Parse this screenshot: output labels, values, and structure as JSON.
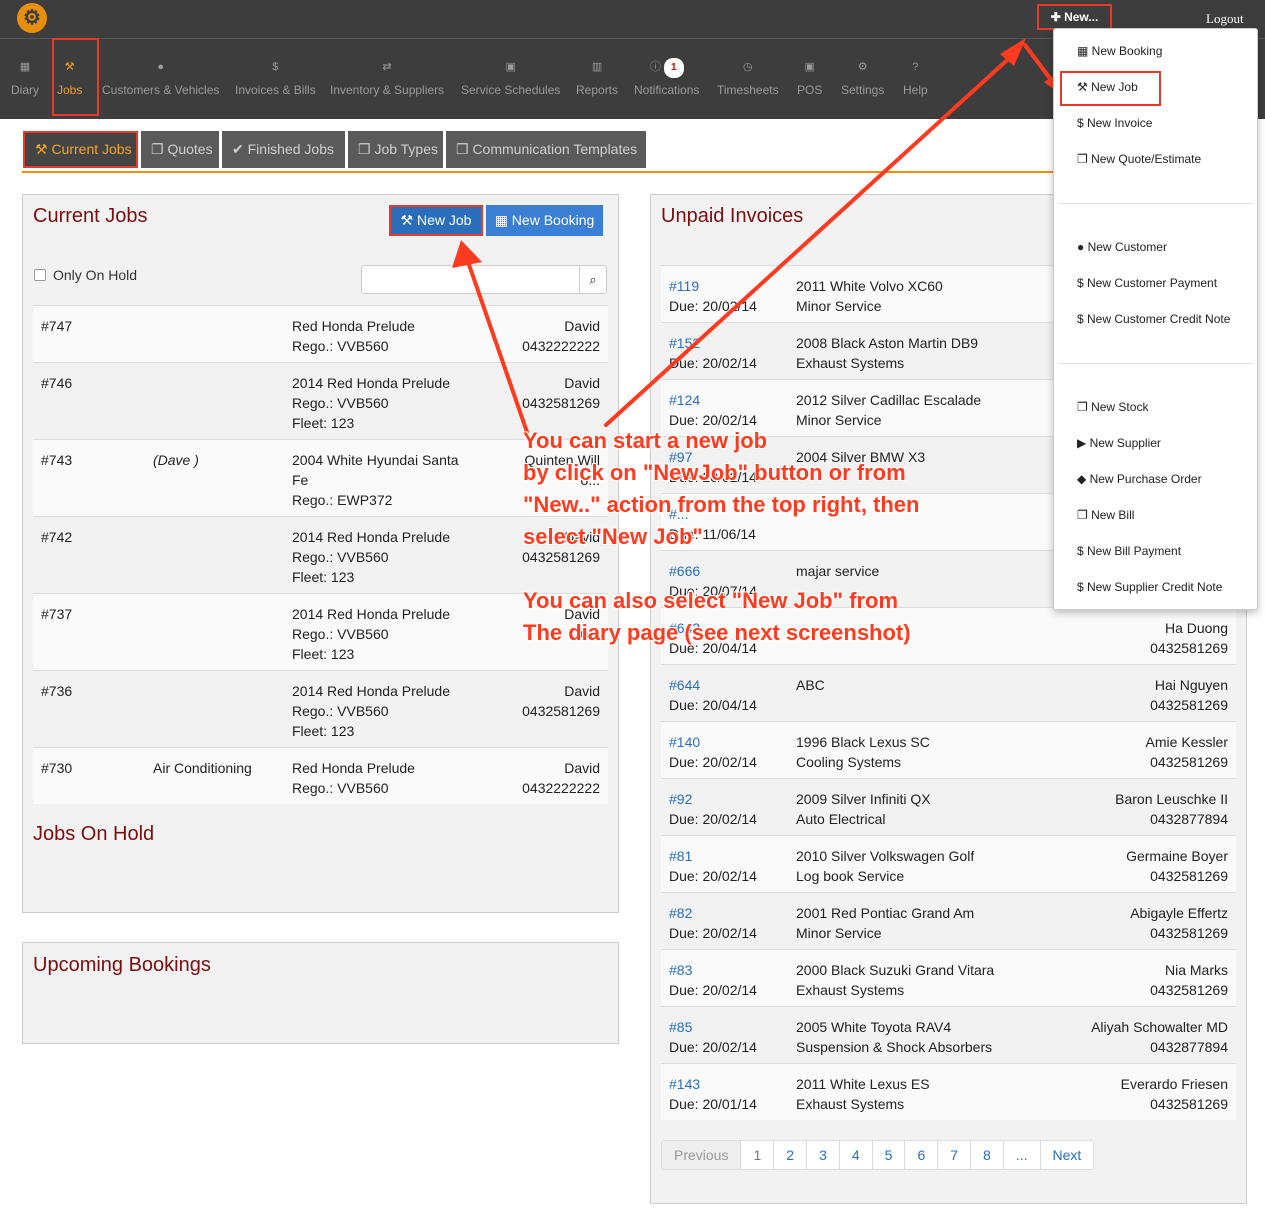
{
  "topbar": {
    "logo": "⚙",
    "new_label": "✚ New...",
    "logout_label": "Logout"
  },
  "nav": [
    {
      "label": "Diary",
      "icon": "▦"
    },
    {
      "label": "Jobs",
      "icon": "⚒"
    },
    {
      "label": "Customers & Vehicles",
      "icon": "●"
    },
    {
      "label": "Invoices & Bills",
      "icon": "$"
    },
    {
      "label": "Inventory & Suppliers",
      "icon": "⇄"
    },
    {
      "label": "Service Schedules",
      "icon": "▣"
    },
    {
      "label": "Reports",
      "icon": "▥"
    },
    {
      "label": "Notifications",
      "icon": "ⓘ",
      "badge": "1"
    },
    {
      "label": "Timesheets",
      "icon": "◷"
    },
    {
      "label": "POS",
      "icon": "▣"
    },
    {
      "label": "Settings",
      "icon": "⚙"
    },
    {
      "label": "Help",
      "icon": "?"
    }
  ],
  "tabs": [
    "⚒ Current Jobs",
    "❐ Quotes",
    "✔ Finished Jobs",
    "❐ Job Types",
    "❐ Communication Templates"
  ],
  "current_jobs": {
    "title": "Current Jobs",
    "new_job_label": "⚒ New Job",
    "new_booking_label": "▦ New Booking",
    "only_on_hold_label": "Only On Hold",
    "search_icon": "⌕",
    "rows": [
      {
        "id": "#747",
        "note": "",
        "vehicle": [
          "Red Honda Prelude",
          "Rego.: VVB560"
        ],
        "contact": [
          "David",
          "0432222222"
        ]
      },
      {
        "id": "#746",
        "note": "",
        "vehicle": [
          "2014 Red Honda Prelude",
          "Rego.: VVB560",
          "Fleet: 123"
        ],
        "contact": [
          "David",
          "0432581269"
        ]
      },
      {
        "id": "#743",
        "note": "(Dave )",
        "vehicle": [
          "2004 White Hyundai Santa",
          "Fe",
          "Rego.: EWP372"
        ],
        "contact": [
          "Quinten Will",
          "o..."
        ]
      },
      {
        "id": "#742",
        "note": "",
        "vehicle": [
          "2014 Red Honda Prelude",
          "Rego.: VVB560",
          "Fleet: 123"
        ],
        "contact": [
          "David",
          "0432581269"
        ]
      },
      {
        "id": "#737",
        "note": "",
        "vehicle": [
          "2014 Red Honda Prelude",
          "Rego.: VVB560",
          "Fleet: 123"
        ],
        "contact": [
          "David",
          "0..."
        ]
      },
      {
        "id": "#736",
        "note": "",
        "vehicle": [
          "2014 Red Honda Prelude",
          "Rego.: VVB560",
          "Fleet: 123"
        ],
        "contact": [
          "David",
          "0432581269"
        ]
      },
      {
        "id": "#730",
        "note": "Air Conditioning",
        "vehicle": [
          "Red Honda Prelude",
          "Rego.: VVB560"
        ],
        "contact": [
          "David",
          "0432222222"
        ]
      }
    ]
  },
  "jobs_on_hold": {
    "title": "Jobs On Hold"
  },
  "upcoming_bookings": {
    "title": "Upcoming Bookings"
  },
  "unpaid_invoices": {
    "title": "Unpaid Invoices",
    "rows": [
      {
        "id": "#119",
        "due": "Due: 20/02/14",
        "vehicle": [
          "2011 White Volvo XC60",
          "Minor Service"
        ],
        "customer": [
          "",
          ""
        ]
      },
      {
        "id": "#152",
        "due": "Due: 20/02/14",
        "vehicle": [
          "2008 Black Aston Martin DB9",
          "Exhaust Systems"
        ],
        "customer": [
          "",
          ""
        ]
      },
      {
        "id": "#124",
        "due": "Due: 20/02/14",
        "vehicle": [
          "2012 Silver Cadillac Escalade",
          "Minor Service"
        ],
        "customer": [
          "",
          ""
        ]
      },
      {
        "id": "#97",
        "due": "Due: 20/02/14",
        "vehicle": [
          "2004 Silver BMW X3",
          ""
        ],
        "customer": [
          "",
          ""
        ]
      },
      {
        "id": "#...",
        "due": "Due: 11/06/14",
        "vehicle": [
          "",
          ""
        ],
        "customer": [
          "",
          ""
        ]
      },
      {
        "id": "#666",
        "due": "Due: 20/07/14",
        "vehicle": [
          "majar service",
          ""
        ],
        "customer": [
          "",
          ""
        ]
      },
      {
        "id": "#643",
        "due": "Due: 20/04/14",
        "vehicle": [
          "",
          ""
        ],
        "customer": [
          "Ha Duong",
          "0432581269"
        ]
      },
      {
        "id": "#644",
        "due": "Due: 20/04/14",
        "vehicle": [
          "ABC",
          ""
        ],
        "customer": [
          "Hai Nguyen",
          "0432581269"
        ]
      },
      {
        "id": "#140",
        "due": "Due: 20/02/14",
        "vehicle": [
          "1996 Black Lexus SC",
          "Cooling Systems"
        ],
        "customer": [
          "Amie Kessler",
          "0432581269"
        ]
      },
      {
        "id": "#92",
        "due": "Due: 20/02/14",
        "vehicle": [
          "2009 Silver Infiniti QX",
          "Auto Electrical"
        ],
        "customer": [
          "Baron Leuschke II",
          "0432877894"
        ]
      },
      {
        "id": "#81",
        "due": "Due: 20/02/14",
        "vehicle": [
          "2010 Silver Volkswagen Golf",
          "Log book Service"
        ],
        "customer": [
          "Germaine Boyer",
          "0432581269"
        ]
      },
      {
        "id": "#82",
        "due": "Due: 20/02/14",
        "vehicle": [
          "2001 Red Pontiac Grand Am",
          "Minor Service"
        ],
        "customer": [
          "Abigayle Effertz",
          "0432581269"
        ]
      },
      {
        "id": "#83",
        "due": "Due: 20/02/14",
        "vehicle": [
          "2000 Black Suzuki Grand Vitara",
          "Exhaust Systems"
        ],
        "customer": [
          "Nia Marks",
          "0432581269"
        ]
      },
      {
        "id": "#85",
        "due": "Due: 20/02/14",
        "vehicle": [
          "2005 White Toyota RAV4",
          "Suspension & Shock Absorbers"
        ],
        "customer": [
          "Aliyah Schowalter MD",
          "0432877894"
        ]
      },
      {
        "id": "#143",
        "due": "Due: 20/01/14",
        "vehicle": [
          "2011 White Lexus ES",
          "Exhaust Systems"
        ],
        "customer": [
          "Everardo Friesen",
          "0432581269"
        ]
      }
    ]
  },
  "pager": [
    "Previous",
    "1",
    "2",
    "3",
    "4",
    "5",
    "6",
    "7",
    "8",
    "...",
    "Next"
  ],
  "dropdown": {
    "group1": [
      "▦ New Booking",
      "⚒ New Job",
      "$ New Invoice",
      "❐ New Quote/Estimate"
    ],
    "group2": [
      "● New Customer",
      "$ New Customer Payment",
      "$ New Customer Credit Note"
    ],
    "group3": [
      "❐ New Stock",
      "▶ New Supplier",
      "◆ New Purchase Order",
      "❐ New Bill",
      "$ New Bill Payment",
      "$ New Supplier Credit Note"
    ]
  },
  "annotations": {
    "main": "You can start a new job\nby click on \"NewJob\" button or from\n\"New..\" action from the top right, then\nselect \"New Job\"",
    "secondary": "You can also select \"New Job\" from\nThe diary page (see next screenshot)"
  },
  "colors": {
    "accent": "#e8900e",
    "highlight": "#e53b2a",
    "link": "#2a6ebb",
    "title": "#7b0f0f"
  }
}
